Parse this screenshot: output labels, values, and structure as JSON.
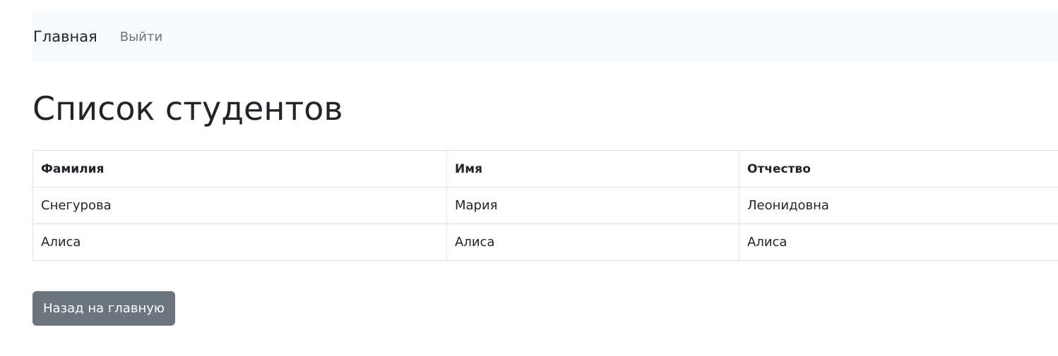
{
  "nav": {
    "brand": "Главная",
    "logout": "Выйти"
  },
  "page": {
    "title": "Список студентов"
  },
  "table": {
    "headers": [
      "Фамилия",
      "Имя",
      "Отчество"
    ],
    "rows": [
      [
        "Снегурова",
        "Мария",
        "Леонидовна"
      ],
      [
        "Алиса",
        "Алиса",
        "Алиса"
      ]
    ]
  },
  "actions": {
    "back_label": "Назад на главную"
  },
  "colors": {
    "navbar_bg": "#f8f9fa",
    "button_bg": "#6c757d",
    "border": "#dee2e6",
    "text": "#212529",
    "muted": "#6c757d"
  }
}
